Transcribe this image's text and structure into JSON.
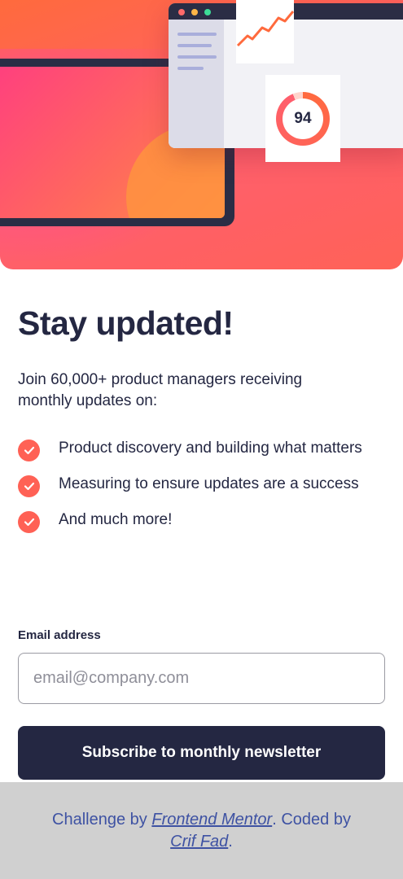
{
  "hero": {
    "score": "94",
    "colors": {
      "accent": "#ff6155",
      "dark": "#242742",
      "window_dots": [
        "#ff6a6a",
        "#ffb547",
        "#3ddc97"
      ]
    }
  },
  "main": {
    "title": "Stay updated!",
    "intro": "Join 60,000+ product managers receiving monthly updates on:",
    "features": [
      {
        "icon": "check-icon",
        "text": "Product discovery and building what matters"
      },
      {
        "icon": "check-icon",
        "text": "Measuring to ensure updates are a success"
      },
      {
        "icon": "check-icon",
        "text": "And much more!"
      }
    ]
  },
  "form": {
    "email_label": "Email address",
    "email_placeholder": "email@company.com",
    "email_value": "",
    "submit_label": "Subscribe to monthly newsletter"
  },
  "footer": {
    "prefix": "Challenge by ",
    "challenge_link": "Frontend Mentor",
    "middle": ". Coded by ",
    "author_link": "Crif Fad",
    "suffix": "."
  }
}
